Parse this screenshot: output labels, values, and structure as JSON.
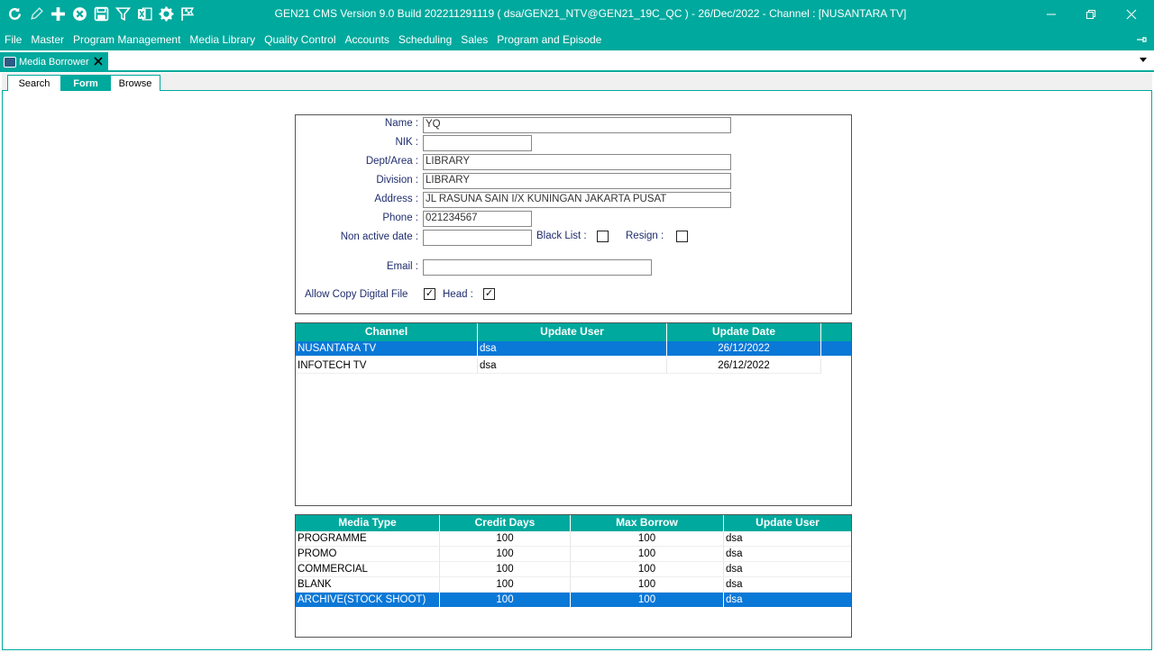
{
  "title_bar": {
    "title": "GEN21 CMS Version 9.0 Build 202211291119 ( dsa/GEN21_NTV@GEN21_19C_QC ) - 26/Dec/2022 - Channel : [NUSANTARA TV]",
    "toolbar_icons": [
      "refresh-icon",
      "pencil-icon",
      "plus-icon",
      "close-circle-icon",
      "save-icon",
      "filter-icon",
      "excel-icon",
      "gear-icon",
      "flag-icon"
    ]
  },
  "menu": {
    "items": [
      "File",
      "Master",
      "Program Management",
      "Media Library",
      "Quality Control",
      "Accounts",
      "Scheduling",
      "Sales",
      "Program and Episode"
    ]
  },
  "doc_tab": {
    "label": "Media Borrower"
  },
  "subtabs": {
    "search": "Search",
    "form": "Form",
    "browse": "Browse",
    "active": "Form"
  },
  "form": {
    "name_label": "Name :",
    "name_value": "YQ",
    "nik_label": "NIK :",
    "nik_value": "",
    "dept_label": "Dept/Area :",
    "dept_value": "LIBRARY",
    "division_label": "Division :",
    "division_value": "LIBRARY",
    "address_label": "Address :",
    "address_value": "JL RASUNA SAIN I/X KUNINGAN JAKARTA PUSAT",
    "phone_label": "Phone :",
    "phone_value": "021234567",
    "nonactive_label": "Non active date :",
    "nonactive_value": "",
    "blacklist_label": "Black List :",
    "blacklist_checked": false,
    "resign_label": "Resign :",
    "resign_checked": false,
    "email_label": "Email :",
    "email_value": "",
    "allowcopy_label": "Allow Copy Digital File",
    "allowcopy_checked": true,
    "head_label": "Head :",
    "head_checked": true,
    "check_mark": "✓"
  },
  "channel_grid": {
    "headers": [
      "Channel",
      "Update User",
      "Update Date"
    ],
    "rows": [
      {
        "channel": "NUSANTARA TV",
        "user": "dsa",
        "date": "26/12/2022",
        "selected": true
      },
      {
        "channel": "INFOTECH TV",
        "user": "dsa",
        "date": "26/12/2022",
        "selected": false
      }
    ]
  },
  "media_grid": {
    "headers": [
      "Media Type",
      "Credit Days",
      "Max Borrow",
      "Update User"
    ],
    "rows": [
      {
        "type": "PROGRAMME",
        "credit": "100",
        "max": "100",
        "user": "dsa",
        "selected": false
      },
      {
        "type": "PROMO",
        "credit": "100",
        "max": "100",
        "user": "dsa",
        "selected": false
      },
      {
        "type": "COMMERCIAL",
        "credit": "100",
        "max": "100",
        "user": "dsa",
        "selected": false
      },
      {
        "type": "BLANK",
        "credit": "100",
        "max": "100",
        "user": "dsa",
        "selected": false
      },
      {
        "type": "ARCHIVE(STOCK SHOOT)",
        "credit": "100",
        "max": "100",
        "user": "dsa",
        "selected": true
      }
    ]
  },
  "colors": {
    "accent": "#00a99d",
    "selection": "#0a78d7",
    "label": "#1f2d6e"
  }
}
